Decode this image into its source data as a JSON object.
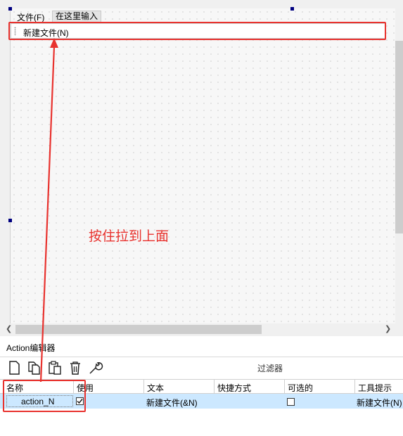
{
  "menubar": {
    "file_label": "文件(F)",
    "type_here_label": "在这里输入"
  },
  "submenu": {
    "item_label": "新建文件(N)"
  },
  "annotation": {
    "text": "按住拉到上面",
    "color": "#e8322e"
  },
  "action_editor": {
    "title": "Action编辑器",
    "toolbar_icons": [
      "new-action-icon",
      "copy-icon",
      "paste-icon",
      "delete-icon",
      "settings-wrench-icon"
    ],
    "filter_label": "过滤器",
    "columns": [
      "名称",
      "使用",
      "文本",
      "快捷方式",
      "可选的",
      "工具提示"
    ],
    "rows": [
      {
        "name": "action_N",
        "used": true,
        "text": "新建文件(&N)",
        "shortcut": "",
        "checkable": false,
        "tooltip": "新建文件(N)"
      }
    ]
  },
  "colors": {
    "highlight": "#e8322e",
    "selected_row": "#cce8ff",
    "selection_handle": "#000080"
  }
}
